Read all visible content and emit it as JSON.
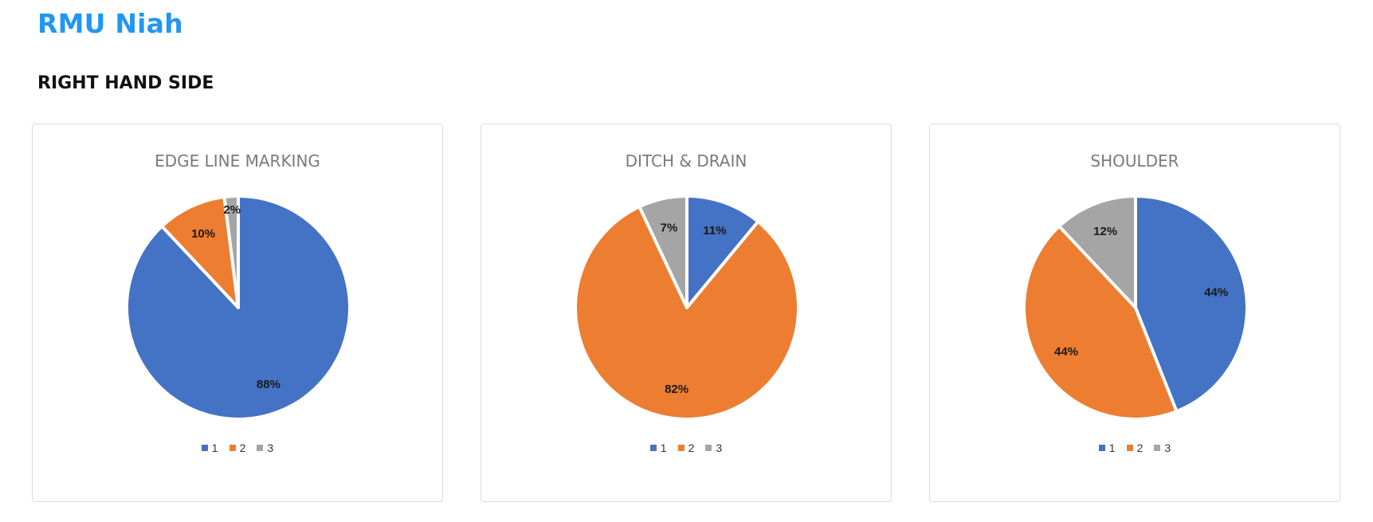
{
  "header": {
    "app_title": "RMU Niah",
    "section_title": "RIGHT HAND SIDE"
  },
  "colors": {
    "title": "#2196f3",
    "slice_1": "#4472c4",
    "slice_2": "#ed7d31",
    "slice_3": "#a5a5a5"
  },
  "chart_data": [
    {
      "type": "pie",
      "title": "EDGE LINE MARKING",
      "categories": [
        "1",
        "2",
        "3"
      ],
      "values": [
        88,
        10,
        2
      ],
      "labels": [
        "88%",
        "10%",
        "2%"
      ],
      "colors": [
        "#4472c4",
        "#ed7d31",
        "#a5a5a5"
      ],
      "legend": "bottom"
    },
    {
      "type": "pie",
      "title": "DITCH & DRAIN",
      "categories": [
        "1",
        "2",
        "3"
      ],
      "values": [
        11,
        82,
        7
      ],
      "labels": [
        "11%",
        "82%",
        "7%"
      ],
      "colors": [
        "#4472c4",
        "#ed7d31",
        "#a5a5a5"
      ],
      "legend": "bottom"
    },
    {
      "type": "pie",
      "title": "SHOULDER",
      "categories": [
        "1",
        "2",
        "3"
      ],
      "values": [
        44,
        44,
        12
      ],
      "labels": [
        "44%",
        "44%",
        "12%"
      ],
      "colors": [
        "#4472c4",
        "#ed7d31",
        "#a5a5a5"
      ],
      "legend": "bottom"
    }
  ]
}
